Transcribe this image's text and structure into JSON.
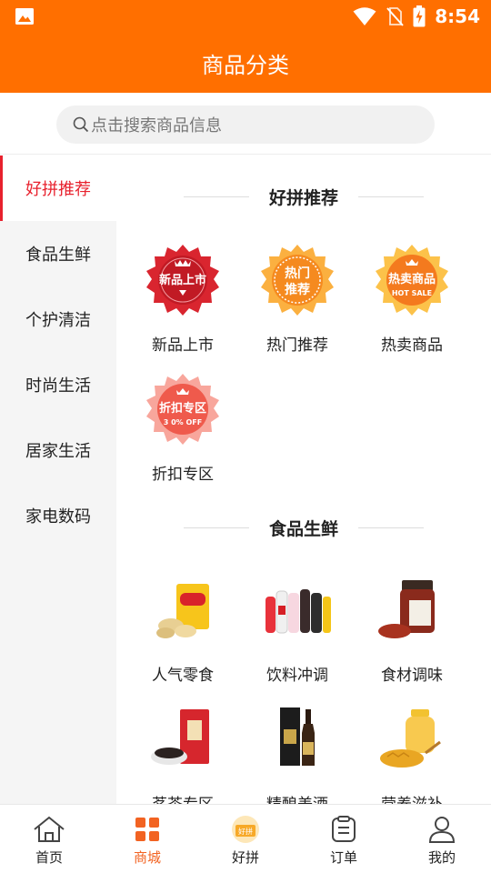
{
  "status_bar": {
    "time": "8:54"
  },
  "header": {
    "title": "商品分类"
  },
  "search": {
    "placeholder": "点击搜索商品信息"
  },
  "sidebar": {
    "items": [
      {
        "label": "好拼推荐",
        "active": true
      },
      {
        "label": "食品生鲜",
        "active": false
      },
      {
        "label": "个护清洁",
        "active": false
      },
      {
        "label": "时尚生活",
        "active": false
      },
      {
        "label": "居家生活",
        "active": false
      },
      {
        "label": "家电数码",
        "active": false
      }
    ]
  },
  "sections": [
    {
      "title": "好拼推荐",
      "items": [
        {
          "label": "新品上市",
          "badge_line1": "新品上市",
          "badge_color": "#d9252f"
        },
        {
          "label": "热门推荐",
          "badge_line1": "热门",
          "badge_line2": "推荐",
          "badge_color": "#f58a1f"
        },
        {
          "label": "热卖商品",
          "badge_line1": "热卖商品",
          "badge_line2": "HOT SALE",
          "badge_color": "#f47a1e"
        },
        {
          "label": "折扣专区",
          "badge_line1": "折扣专区",
          "badge_line2": "3 0% OFF",
          "badge_color": "#ef5a4c"
        }
      ]
    },
    {
      "title": "食品生鲜",
      "items": [
        {
          "label": "人气零食",
          "icon": "snack-icon"
        },
        {
          "label": "饮料冲调",
          "icon": "drinks-icon"
        },
        {
          "label": "食材调味",
          "icon": "sauce-jar-icon"
        },
        {
          "label": "茗茶专区",
          "icon": "tea-icon"
        },
        {
          "label": "精酿美酒",
          "icon": "liquor-bottle-icon"
        },
        {
          "label": "营养滋补",
          "icon": "honey-icon"
        }
      ]
    }
  ],
  "tabbar": {
    "tabs": [
      {
        "label": "首页",
        "icon": "home-icon"
      },
      {
        "label": "商城",
        "icon": "grid-icon",
        "active": true
      },
      {
        "label": "好拼",
        "icon": "haopin-icon",
        "badge_text": "好拼"
      },
      {
        "label": "订单",
        "icon": "order-icon"
      },
      {
        "label": "我的",
        "icon": "user-icon"
      }
    ]
  },
  "colors": {
    "brand": "#ff6f00",
    "accent_red": "#e8212d",
    "active_tab": "#f26322"
  }
}
